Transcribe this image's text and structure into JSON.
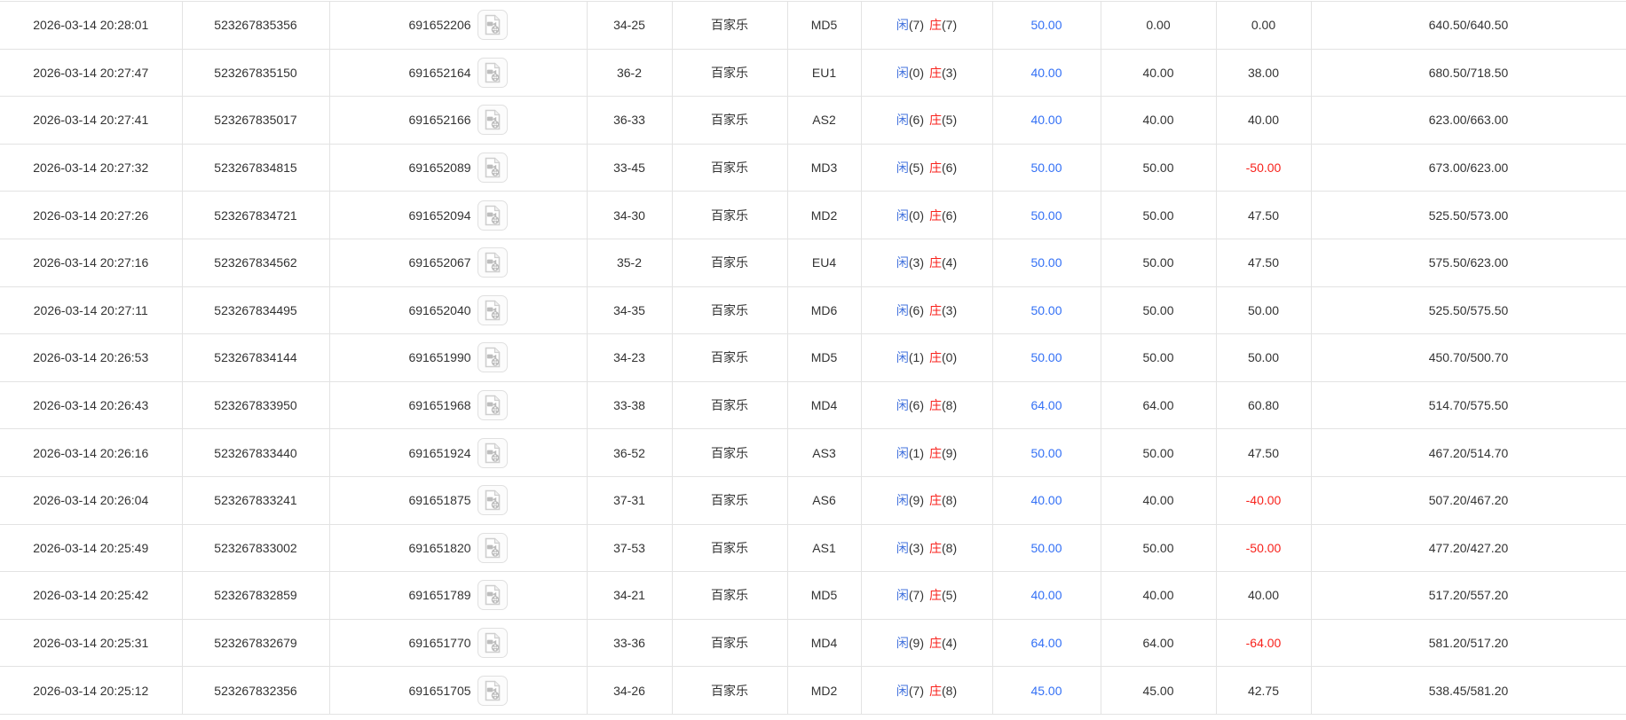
{
  "table": {
    "labels": {
      "player": "闲",
      "banker": "庄"
    },
    "colors": {
      "text": "#333333",
      "border": "#e3e3e3",
      "bet_amount_blue": "#3370f5",
      "player_blue": "#4272dd",
      "banker_red": "#f8221c",
      "negative_red": "#f8221c"
    },
    "columns": [
      "bet-time",
      "bet-number",
      "round-number",
      "shoe-round",
      "game-name",
      "table-code",
      "player-banker-points",
      "bet-amount",
      "valid-amount",
      "win-loss",
      "balance"
    ],
    "rows": [
      {
        "time": "2026-03-14 20:28:01",
        "bet_no": "523267835356",
        "round_no": "691652206",
        "shoe": "34-25",
        "game": "百家乐",
        "table_code": "MD5",
        "player_n": "(7)",
        "banker_n": "(7)",
        "bet": "50.00",
        "valid": "0.00",
        "result": "0.00",
        "balance": "640.50/640.50"
      },
      {
        "time": "2026-03-14 20:27:47",
        "bet_no": "523267835150",
        "round_no": "691652164",
        "shoe": "36-2",
        "game": "百家乐",
        "table_code": "EU1",
        "player_n": "(0)",
        "banker_n": "(3)",
        "bet": "40.00",
        "valid": "40.00",
        "result": "38.00",
        "balance": "680.50/718.50"
      },
      {
        "time": "2026-03-14 20:27:41",
        "bet_no": "523267835017",
        "round_no": "691652166",
        "shoe": "36-33",
        "game": "百家乐",
        "table_code": "AS2",
        "player_n": "(6)",
        "banker_n": "(5)",
        "bet": "40.00",
        "valid": "40.00",
        "result": "40.00",
        "balance": "623.00/663.00"
      },
      {
        "time": "2026-03-14 20:27:32",
        "bet_no": "523267834815",
        "round_no": "691652089",
        "shoe": "33-45",
        "game": "百家乐",
        "table_code": "MD3",
        "player_n": "(5)",
        "banker_n": "(6)",
        "bet": "50.00",
        "valid": "50.00",
        "result": "-50.00",
        "balance": "673.00/623.00"
      },
      {
        "time": "2026-03-14 20:27:26",
        "bet_no": "523267834721",
        "round_no": "691652094",
        "shoe": "34-30",
        "game": "百家乐",
        "table_code": "MD2",
        "player_n": "(0)",
        "banker_n": "(6)",
        "bet": "50.00",
        "valid": "50.00",
        "result": "47.50",
        "balance": "525.50/573.00"
      },
      {
        "time": "2026-03-14 20:27:16",
        "bet_no": "523267834562",
        "round_no": "691652067",
        "shoe": "35-2",
        "game": "百家乐",
        "table_code": "EU4",
        "player_n": "(3)",
        "banker_n": "(4)",
        "bet": "50.00",
        "valid": "50.00",
        "result": "47.50",
        "balance": "575.50/623.00"
      },
      {
        "time": "2026-03-14 20:27:11",
        "bet_no": "523267834495",
        "round_no": "691652040",
        "shoe": "34-35",
        "game": "百家乐",
        "table_code": "MD6",
        "player_n": "(6)",
        "banker_n": "(3)",
        "bet": "50.00",
        "valid": "50.00",
        "result": "50.00",
        "balance": "525.50/575.50"
      },
      {
        "time": "2026-03-14 20:26:53",
        "bet_no": "523267834144",
        "round_no": "691651990",
        "shoe": "34-23",
        "game": "百家乐",
        "table_code": "MD5",
        "player_n": "(1)",
        "banker_n": "(0)",
        "bet": "50.00",
        "valid": "50.00",
        "result": "50.00",
        "balance": "450.70/500.70"
      },
      {
        "time": "2026-03-14 20:26:43",
        "bet_no": "523267833950",
        "round_no": "691651968",
        "shoe": "33-38",
        "game": "百家乐",
        "table_code": "MD4",
        "player_n": "(6)",
        "banker_n": "(8)",
        "bet": "64.00",
        "valid": "64.00",
        "result": "60.80",
        "balance": "514.70/575.50"
      },
      {
        "time": "2026-03-14 20:26:16",
        "bet_no": "523267833440",
        "round_no": "691651924",
        "shoe": "36-52",
        "game": "百家乐",
        "table_code": "AS3",
        "player_n": "(1)",
        "banker_n": "(9)",
        "bet": "50.00",
        "valid": "50.00",
        "result": "47.50",
        "balance": "467.20/514.70"
      },
      {
        "time": "2026-03-14 20:26:04",
        "bet_no": "523267833241",
        "round_no": "691651875",
        "shoe": "37-31",
        "game": "百家乐",
        "table_code": "AS6",
        "player_n": "(9)",
        "banker_n": "(8)",
        "bet": "40.00",
        "valid": "40.00",
        "result": "-40.00",
        "balance": "507.20/467.20"
      },
      {
        "time": "2026-03-14 20:25:49",
        "bet_no": "523267833002",
        "round_no": "691651820",
        "shoe": "37-53",
        "game": "百家乐",
        "table_code": "AS1",
        "player_n": "(3)",
        "banker_n": "(8)",
        "bet": "50.00",
        "valid": "50.00",
        "result": "-50.00",
        "balance": "477.20/427.20"
      },
      {
        "time": "2026-03-14 20:25:42",
        "bet_no": "523267832859",
        "round_no": "691651789",
        "shoe": "34-21",
        "game": "百家乐",
        "table_code": "MD5",
        "player_n": "(7)",
        "banker_n": "(5)",
        "bet": "40.00",
        "valid": "40.00",
        "result": "40.00",
        "balance": "517.20/557.20"
      },
      {
        "time": "2026-03-14 20:25:31",
        "bet_no": "523267832679",
        "round_no": "691651770",
        "shoe": "33-36",
        "game": "百家乐",
        "table_code": "MD4",
        "player_n": "(9)",
        "banker_n": "(4)",
        "bet": "64.00",
        "valid": "64.00",
        "result": "-64.00",
        "balance": "581.20/517.20"
      },
      {
        "time": "2026-03-14 20:25:12",
        "bet_no": "523267832356",
        "round_no": "691651705",
        "shoe": "34-26",
        "game": "百家乐",
        "table_code": "MD2",
        "player_n": "(7)",
        "banker_n": "(8)",
        "bet": "45.00",
        "valid": "45.00",
        "result": "42.75",
        "balance": "538.45/581.20"
      }
    ]
  }
}
